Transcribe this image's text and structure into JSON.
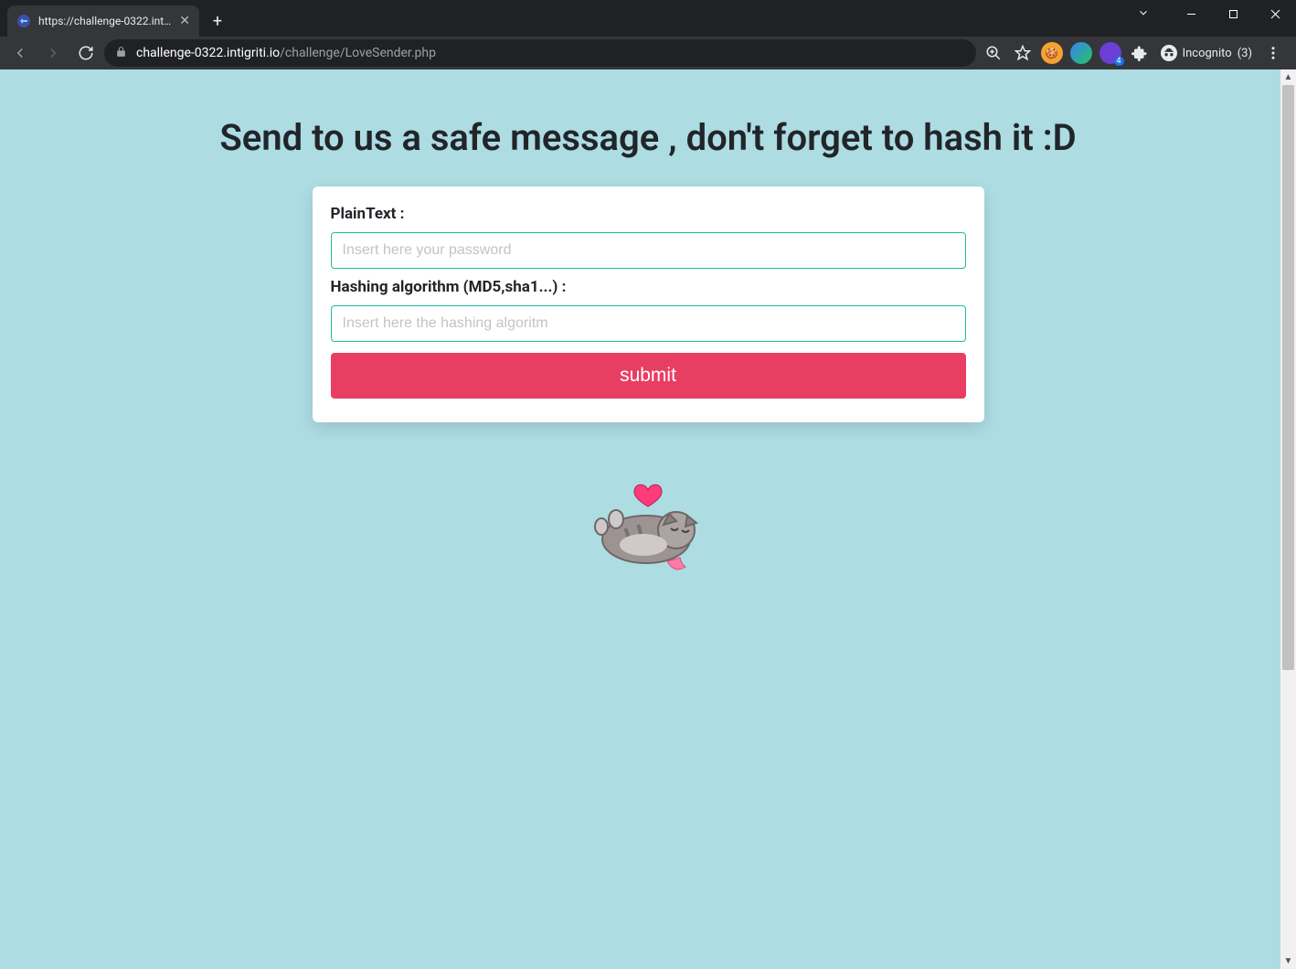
{
  "browser": {
    "tab_title": "https://challenge-0322.intigriti.io",
    "url_host": "challenge-0322.intigriti.io",
    "url_path": "/challenge/LoveSender.php",
    "incognito_label": "Incognito",
    "incognito_count": "(3)",
    "ext_badge": "4"
  },
  "page": {
    "heading": "Send to us a safe message , don't forget to hash it :D",
    "form": {
      "plaintext_label": "PlainText :",
      "plaintext_placeholder": "Insert here your password",
      "plaintext_value": "",
      "algo_label": "Hashing algorithm (MD5,sha1...) :",
      "algo_placeholder": "Insert here the hashing algoritm",
      "algo_value": "",
      "submit_label": "submit"
    }
  }
}
